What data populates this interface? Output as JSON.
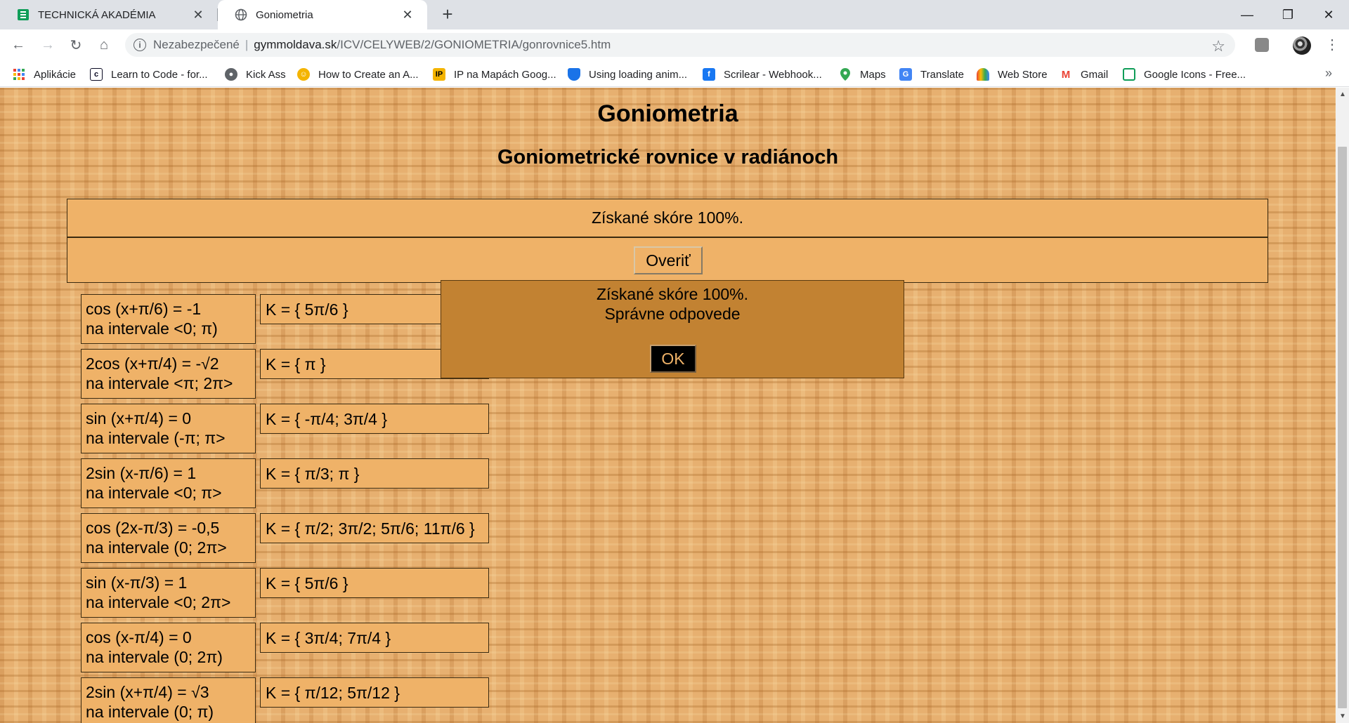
{
  "browser": {
    "tabs": [
      {
        "title": "TECHNICKÁ AKADÉMIA",
        "active": false
      },
      {
        "title": "Goniometria",
        "active": true
      }
    ],
    "address": {
      "security": "Nezabezpečené",
      "host": "gymmoldava.sk",
      "path": "/ICV/CELYWEB/2/GONIOMETRIA/gonrovnice5.htm"
    },
    "bookmarks": [
      {
        "label": "Aplikácie",
        "icon": "apps-grid-icon",
        "color": "#ea4335"
      },
      {
        "label": "Learn to Code - for...",
        "icon": "freecodecamp-icon",
        "color": "#0a0a23"
      },
      {
        "label": "Kick Ass",
        "icon": "kickass-icon",
        "color": "#5f6368"
      },
      {
        "label": "How to Create an A...",
        "icon": "character-icon",
        "color": "#f4b400"
      },
      {
        "label": "IP na Mapách Goog...",
        "icon": "ip-icon",
        "color": "#f4b400"
      },
      {
        "label": "Using loading anim...",
        "icon": "shield-icon",
        "color": "#1a73e8"
      },
      {
        "label": "Scrilear - Webhook...",
        "icon": "facebook-icon",
        "color": "#1877f2"
      },
      {
        "label": "Maps",
        "icon": "maps-pin-icon",
        "color": "#34a853"
      },
      {
        "label": "Translate",
        "icon": "translate-icon",
        "color": "#4285f4"
      },
      {
        "label": "Web Store",
        "icon": "webstore-icon",
        "color": "#ea4335"
      },
      {
        "label": "Gmail",
        "icon": "gmail-icon",
        "color": "#ea4335"
      },
      {
        "label": "Google Icons - Free...",
        "icon": "google-icons-icon",
        "color": "#0f9d58"
      }
    ]
  },
  "page": {
    "title": "Goniometria",
    "subtitle": "Goniometrické rovnice v radiánoch",
    "score_text": "Získané skóre 100%.",
    "verify_label": "Overiť",
    "equations": [
      {
        "eq": "cos (x+π/6) = -1",
        "interval": "na intervale <0; π)",
        "answer": "K = { 5π/6 }"
      },
      {
        "eq": "2cos (x+π/4) = -√2",
        "interval": "na intervale <π; 2π>",
        "answer": "K = { π }"
      },
      {
        "eq": "sin (x+π/4) = 0",
        "interval": "na intervale (-π; π>",
        "answer": "K = { -π/4; 3π/4 }"
      },
      {
        "eq": "2sin (x-π/6) = 1",
        "interval": "na intervale <0; π>",
        "answer": "K = { π/3; π }"
      },
      {
        "eq": "cos (2x-π/3) = -0,5",
        "interval": "na intervale (0; 2π>",
        "answer": "K = { π/2; 3π/2; 5π/6; 11π/6 }"
      },
      {
        "eq": "sin (x-π/3) = 1",
        "interval": "na intervale <0; 2π>",
        "answer": "K = { 5π/6 }"
      },
      {
        "eq": "cos (x-π/4) = 0",
        "interval": "na intervale (0; 2π)",
        "answer": "K = { 3π/4; 7π/4 }"
      },
      {
        "eq": "2sin (x+π/4) = √3",
        "interval": "na intervale (0; π)",
        "answer": "K = { π/12; 5π/12 }"
      }
    ],
    "modal": {
      "line1": "Získané skóre 100%.",
      "line2": "Správne odpovede",
      "ok_label": "OK"
    }
  }
}
